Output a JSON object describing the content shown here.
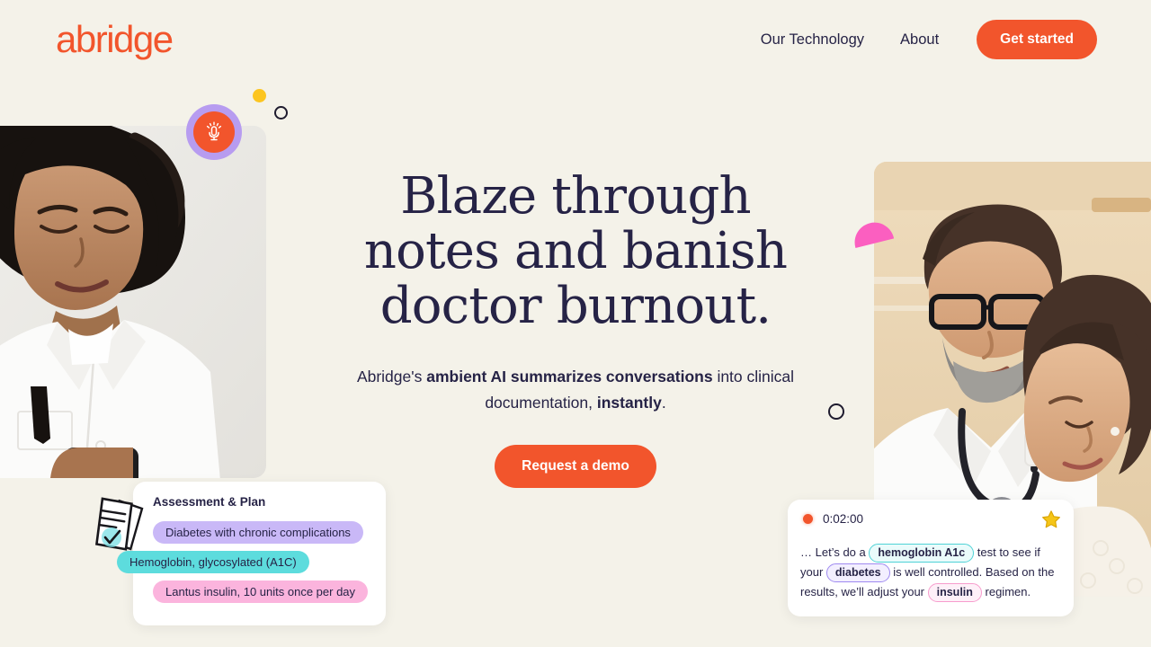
{
  "brand": {
    "logo_text": "abridge",
    "accent_color": "#f2552c",
    "ink_color": "#262346",
    "background_color": "#f4f2e9"
  },
  "nav": {
    "links": [
      {
        "label": "Our Technology",
        "name": "nav-link-our-technology"
      },
      {
        "label": "About",
        "name": "nav-link-about"
      }
    ],
    "cta_label": "Get started"
  },
  "hero": {
    "heading_line_1": "Blaze through",
    "heading_line_2": "notes and banish",
    "heading_line_3": "doctor burnout.",
    "sub_part_1": "Abridge's ",
    "sub_bold_1": "ambient AI summarizes conversations",
    "sub_part_2": " into clinical documentation, ",
    "sub_bold_2": "instantly",
    "sub_part_3": ".",
    "cta_label": "Request a demo"
  },
  "assessment_card": {
    "title": "Assessment & Plan",
    "pills": [
      {
        "label": "Diabetes with chronic complications",
        "color": "#c9b8f7"
      },
      {
        "label": "Hemoglobin, glycosylated (A1C)",
        "color": "#5ddcdd"
      },
      {
        "label": "Lantus insulin, 10 units once per day",
        "color": "#fbb4dd"
      }
    ]
  },
  "transcript_card": {
    "timestamp": "0:02:00",
    "text_1": "… Let’s do a ",
    "tag_1": "hemoglobin A1c",
    "text_2": " test to see if your ",
    "tag_2": "diabetes",
    "text_3": " is well controlled. Based on the results, we’ll adjust your ",
    "tag_3": "insulin",
    "text_4": " regimen."
  },
  "decorations": {
    "mic_badge": "microphone-badge",
    "yellow_dot": "#fcc520",
    "pink_dome": "#fb5fc0",
    "ring_outline": "#1e1b2e"
  }
}
